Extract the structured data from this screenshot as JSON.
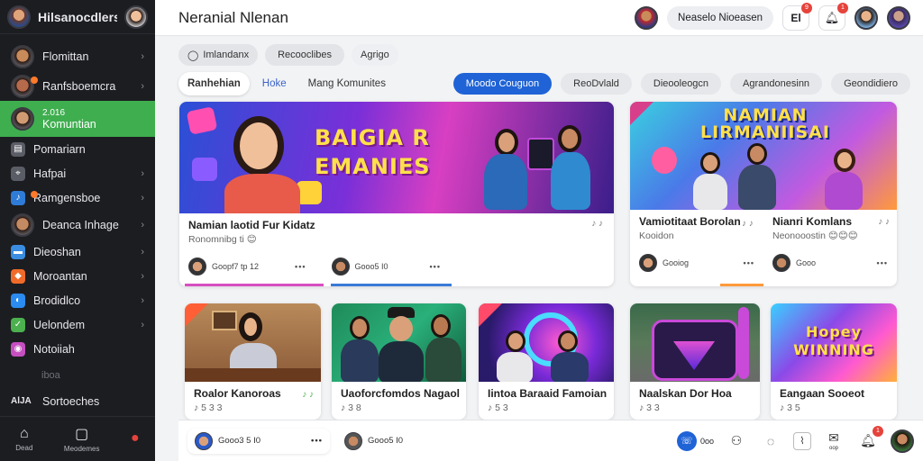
{
  "sidebar": {
    "brand": "Hilsanocdlers",
    "items": [
      {
        "label": "Flomittan",
        "icon": "avatar",
        "color": "#c98b5a",
        "chevron": true
      },
      {
        "label": "Ranfsboemcra",
        "icon": "avatar",
        "color": "#b66a4c",
        "chevron": true,
        "badge": true
      },
      {
        "label": "2.016",
        "label2": "Komuntian",
        "icon": "avatar",
        "color": "#d09b73",
        "active": true
      },
      {
        "label": "Pomariarn",
        "icon": "chat-icon",
        "color": "#5b5d66"
      },
      {
        "label": "Hafpai",
        "icon": "pin-icon",
        "color": "#5b5d66",
        "chevron": true
      },
      {
        "label": "Ramgensboe",
        "icon": "music-icon",
        "color": "#2f7bd8",
        "chevron": true,
        "badge": true
      },
      {
        "label": "Deanca Inhage",
        "icon": "avatar",
        "color": "#c48a62",
        "chevron": true
      },
      {
        "label": "Dieoshan",
        "icon": "folder-icon",
        "color": "#3a8de0",
        "chevron": true
      },
      {
        "label": "Moroantan",
        "icon": "shop-icon",
        "color": "#f06b2a",
        "chevron": true
      },
      {
        "label": "Brodidlco",
        "icon": "game-icon",
        "color": "#2a8bf0",
        "chevron": true
      },
      {
        "label": "Uelondem",
        "icon": "check-icon",
        "color": "#4cb04f",
        "chevron": true
      },
      {
        "label": "Notoiiah",
        "icon": "camera-icon",
        "color": "#c64fc0"
      }
    ],
    "sub_label": "iboa",
    "section_label": "Sortoeches",
    "section_tag": "AlJA",
    "bottom": [
      {
        "label": "Dead",
        "icon": "home-icon"
      },
      {
        "label": "Meodemes",
        "icon": "box-icon"
      },
      {
        "label": "",
        "icon": "alert-icon"
      }
    ]
  },
  "header": {
    "title": "Neranial Nlenan",
    "user_pill": "Neaselo Nioeasen",
    "icon_btn_label": "El",
    "notif_badge": "9",
    "bell_badge": "1"
  },
  "chips": [
    {
      "label": "Imlandanx",
      "icon": "search-icon"
    },
    {
      "label": "Recooclibes"
    },
    {
      "label": "Agrigo"
    }
  ],
  "tabs": [
    {
      "label": "Ranhehian",
      "selected": true
    },
    {
      "label": "Hoke",
      "style": "blue"
    },
    {
      "label": "Mang Komunites"
    }
  ],
  "filters": [
    {
      "label": "Moodo Couguon",
      "primary": true
    },
    {
      "label": "ReoDvlald"
    },
    {
      "label": "Dieooleogcn"
    },
    {
      "label": "Agrandonesinn"
    },
    {
      "label": "Geondidiero"
    }
  ],
  "cards": [
    {
      "title": "Namian laotid Fur Kidatz",
      "sub": "Ronomnibg ti 😊",
      "user": "Goopf7 tp 12",
      "meta": "♪ ♪",
      "banner": "BAIGIA R EMANIES"
    },
    {
      "title": "Vamiotitaat Borolan",
      "sub": "Kooidon",
      "user": "Gooiog",
      "meta": "♪ ♪",
      "banner": "NAMIAN LIRMANIISAI"
    },
    {
      "title": "Nianri Komlans",
      "sub": "Neonooostin 😊😊😊",
      "user": "Gooo",
      "meta": "♪ ♪"
    },
    {
      "title": "Roalor Kanoroas",
      "sub": "♪ 5 3 3",
      "meta": "♪ ♪"
    },
    {
      "title": "Uaoforcfomdos Nagaol",
      "sub": "♪ 3 8"
    },
    {
      "title": "Iintoa Baraaid Famoian",
      "sub": "♪ 5 3"
    },
    {
      "title": "Naalskan Dor Hoa",
      "sub": "♪ 3 3"
    },
    {
      "title": "Eangaan Sooeot",
      "sub": "♪ 3 5",
      "banner": "Hopey WINNING"
    }
  ],
  "footer_users": [
    {
      "label": "Gooo3 5 I0"
    },
    {
      "label": "Gooo5 I0"
    }
  ],
  "bottom_icons": [
    {
      "label": "0oo",
      "icon": "phone-icon"
    },
    {
      "label": "",
      "icon": "person-icon"
    },
    {
      "label": "",
      "icon": "chat-bubble-icon"
    },
    {
      "label": "",
      "icon": "chart-icon"
    },
    {
      "label": "oop",
      "icon": "message-icon"
    },
    {
      "label": "",
      "icon": "bell-icon",
      "badge": "1"
    }
  ]
}
